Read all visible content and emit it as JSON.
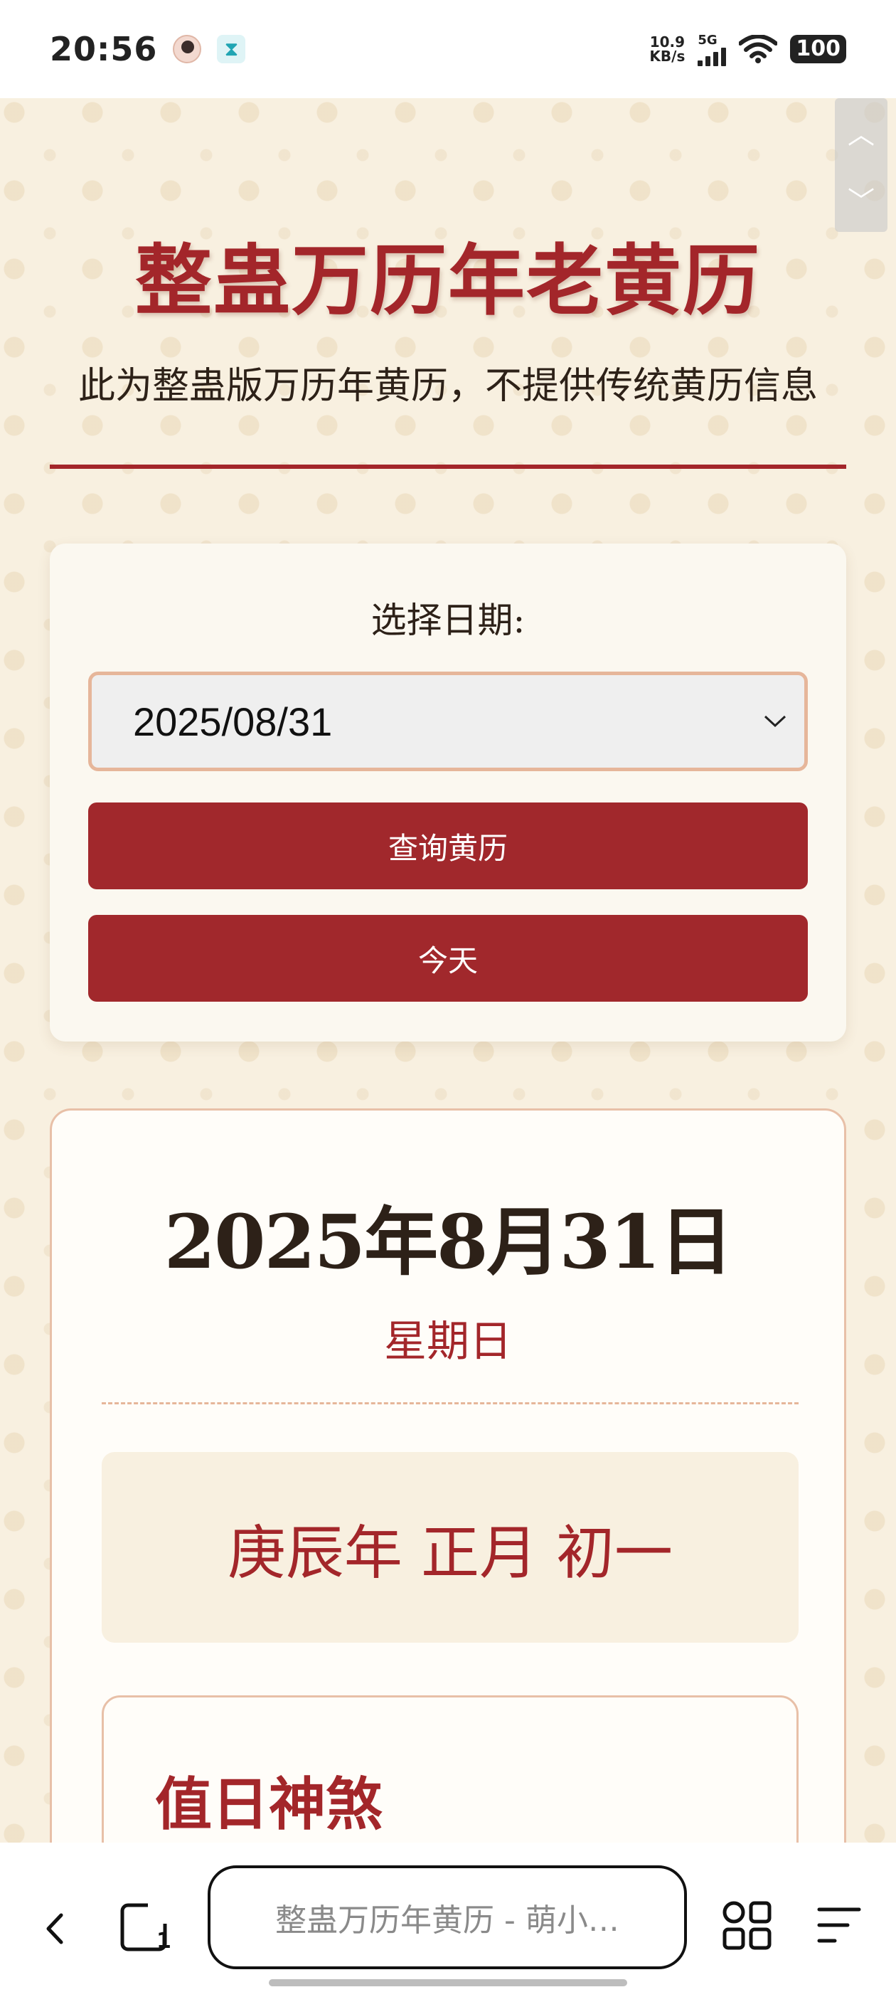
{
  "status_bar": {
    "time": "20:56",
    "net_speed_value": "10.9",
    "net_speed_unit": "KB/s",
    "signal_label": "5G",
    "battery": "100",
    "icons": [
      "avatar-icon",
      "hourglass-icon",
      "signal-icon",
      "wifi-icon",
      "battery-icon"
    ]
  },
  "page": {
    "title": "整蛊万历年老黄历",
    "subtitle": "此为整蛊版万历年黄历，不提供传统黄历信息",
    "date_picker": {
      "label": "选择日期:",
      "value": "2025/08/31"
    },
    "buttons": {
      "query": "查询黄历",
      "today": "今天"
    },
    "result": {
      "solar_date": "2025年8月31日",
      "weekday": "星期日",
      "lunar_date": "庚辰年 正月 初一",
      "section_title": "值日神煞"
    },
    "accent_color": "#a3262a"
  },
  "browser": {
    "url_text": "整蛊万历年黄历 - 萌小…",
    "tab_count": "1"
  }
}
